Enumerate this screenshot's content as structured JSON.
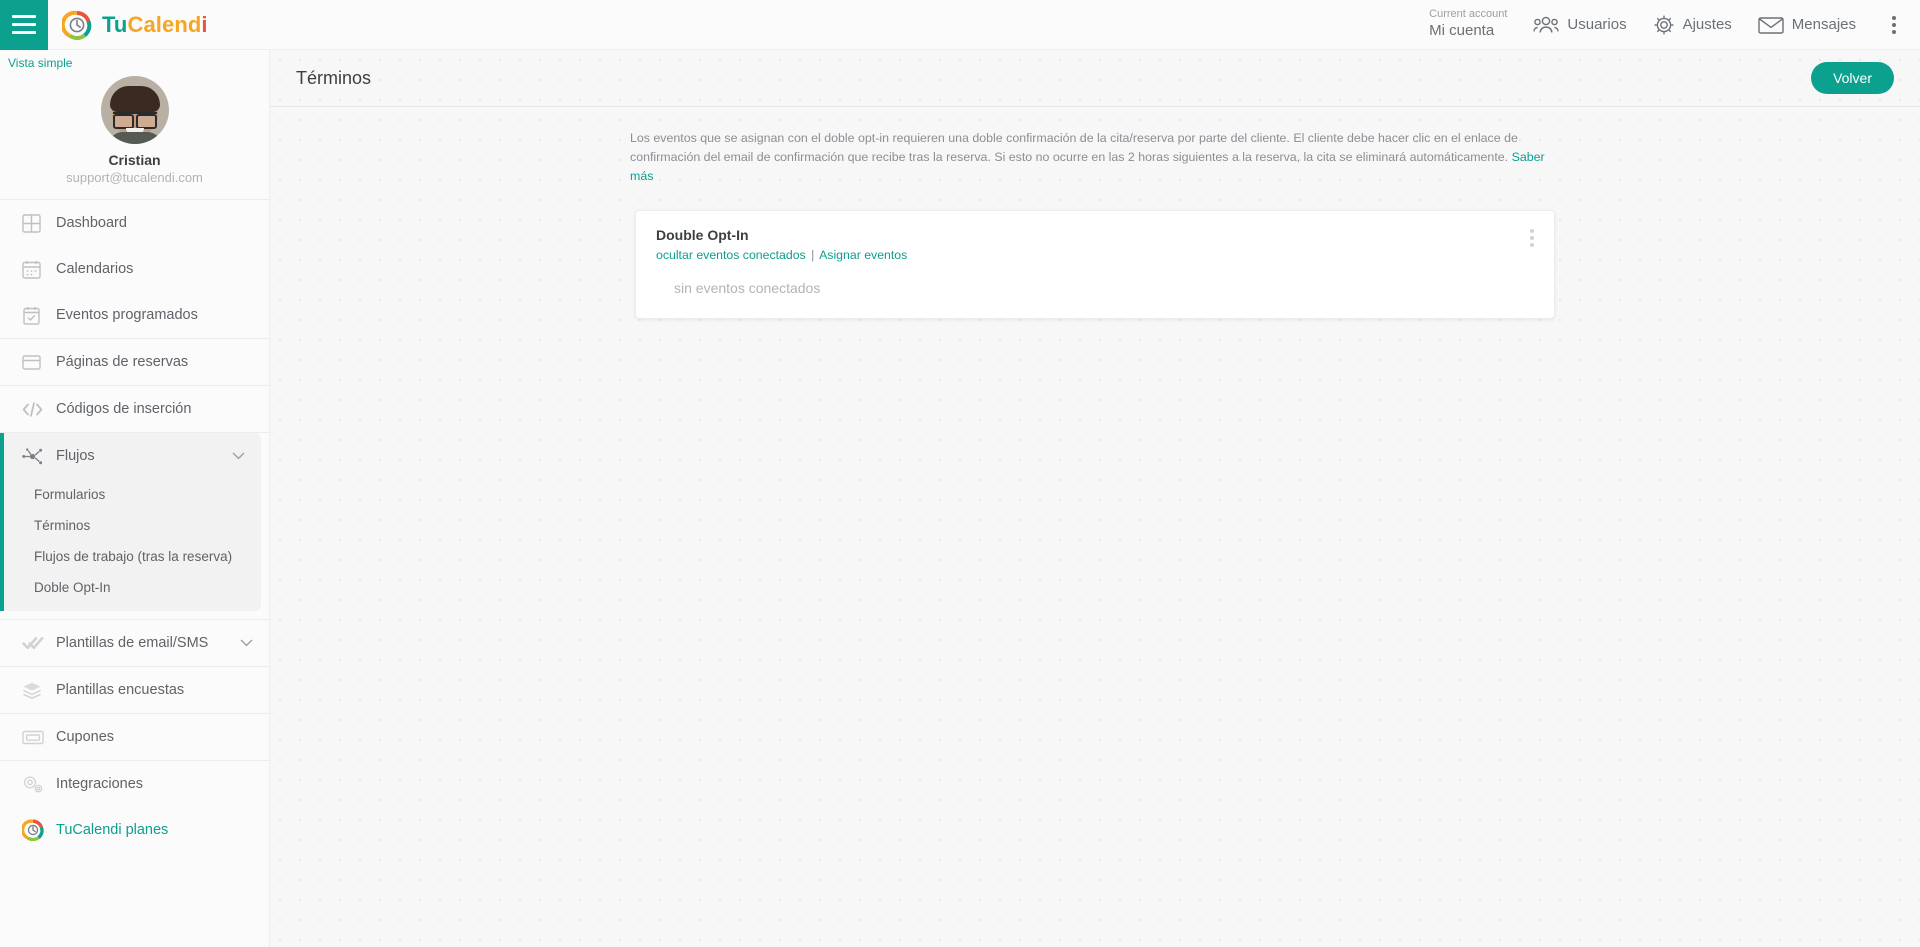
{
  "brand": {
    "part1": "Tu",
    "part2": "Calend",
    "part3": "i",
    "logo_icon": "tucalendi-logo-icon"
  },
  "topbar": {
    "menu_icon": "hamburger-menu-icon",
    "account_label": "Current account",
    "account_value": "Mi cuenta",
    "nav": [
      {
        "label": "Usuarios",
        "icon": "users-icon"
      },
      {
        "label": "Ajustes",
        "icon": "gear-icon"
      },
      {
        "label": "Mensajes",
        "icon": "envelope-icon"
      }
    ],
    "overflow_icon": "kebab-vertical-icon"
  },
  "sidebar": {
    "view_toggle": "Vista simple",
    "profile": {
      "avatar_icon": "user-avatar",
      "name": "Cristian",
      "email": "support@tucalendi.com"
    },
    "items": [
      {
        "label": "Dashboard",
        "icon": "dashboard-grid-icon"
      },
      {
        "label": "Calendarios",
        "icon": "calendar-icon"
      },
      {
        "label": "Eventos programados",
        "icon": "calendar-check-icon"
      },
      {
        "label": "Páginas de reservas",
        "icon": "window-icon"
      },
      {
        "label": "Códigos de inserción",
        "icon": "code-brackets-icon"
      }
    ],
    "flujos": {
      "label": "Flujos",
      "icon": "flow-nodes-icon",
      "chevron": "chevron-down-icon",
      "subitems": [
        {
          "label": "Formularios"
        },
        {
          "label": "Términos"
        },
        {
          "label": "Flujos de trabajo (tras la reserva)"
        },
        {
          "label": "Doble Opt-In"
        }
      ]
    },
    "items_lower": [
      {
        "label": "Plantillas de email/SMS",
        "icon": "double-check-icon",
        "chevron": "chevron-down-icon"
      },
      {
        "label": "Plantillas encuestas",
        "icon": "layers-icon"
      },
      {
        "label": "Cupones",
        "icon": "ticket-icon"
      },
      {
        "label": "Integraciones",
        "icon": "gears-icon"
      }
    ],
    "plans": {
      "label": "TuCalendi planes",
      "icon": "tucalendi-logo-icon"
    }
  },
  "main": {
    "title": "Términos",
    "back_button": "Volver",
    "description_part1": "Los eventos que se asignan con el doble opt-in requieren una doble confirmación de la cita/reserva por parte del cliente. El cliente debe hacer clic en el enlace de confirmación del email de confirmación que recibe tras la reserva. Si esto no ocurre en las 2 horas siguientes a la reserva, la cita se eliminará automáticamente.",
    "description_link": "Saber más",
    "card": {
      "title": "Double Opt-In",
      "link_hide": "ocultar eventos conectados",
      "link_separator": "|",
      "link_assign": "Asignar eventos",
      "empty_text": "sin eventos conectados",
      "menu_icon": "kebab-vertical-icon"
    }
  },
  "colors": {
    "accent": "#0ca08f",
    "orange": "#f5a623",
    "red": "#e8543f",
    "muted": "#8a8f94"
  }
}
